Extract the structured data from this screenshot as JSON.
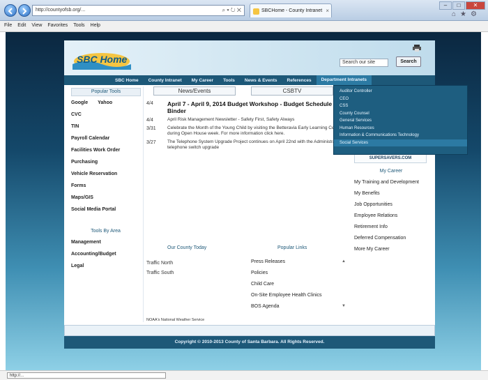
{
  "browser": {
    "address": "http://countyofsb.org/...",
    "tab_title": "SBCHome - County Intranet",
    "menu": [
      "File",
      "Edit",
      "View",
      "Favorites",
      "Tools",
      "Help"
    ],
    "status": "http://..."
  },
  "site": {
    "logo_text": "SBC Home",
    "search_placeholder": "Search our site",
    "search_button": "Search",
    "nav": [
      "SBC Home",
      "County Intranet",
      "My Career",
      "Tools",
      "News & Events",
      "References",
      "Department Intranets"
    ],
    "dropdown": [
      "Auditor Controller",
      "CEO",
      "CSS",
      "County Counsel",
      "General Services",
      "Human Resources",
      "Information & Communications Technology",
      "Social Services"
    ],
    "left": {
      "popular_tools_title": "Popular Tools",
      "tools": [
        [
          "Google",
          "Yahoo"
        ],
        [
          "CVC"
        ],
        [
          "TIN"
        ],
        [
          "Payroll Calendar"
        ],
        [
          "Facilities Work Order"
        ],
        [
          "Purchasing"
        ],
        [
          "Vehicle Reservation"
        ],
        [
          "Forms"
        ],
        [
          "Maps/GIS"
        ],
        [
          "Social Media Portal"
        ]
      ],
      "tools_by_area_title": "Tools By Area",
      "areas": [
        "Management",
        "Accounting/Budget",
        "Legal"
      ]
    },
    "center": {
      "tab_news": "News/Events",
      "tab_csbtv": "CSBTV",
      "news": [
        {
          "date": "4/4",
          "text": "April 7 - April 9, 2014 Budget Workshop - Budget Schedule and Binder",
          "big": true
        },
        {
          "date": "4/4",
          "text": "April Risk Management Newsletter - Safety First, Safety Always",
          "big": false
        },
        {
          "date": "3/31",
          "text": "Celebrate the Month of the Young Child by visiting the Betteravia Early Learning Center during Open House week. For more information click here.",
          "big": false
        },
        {
          "date": "3/27",
          "text": "The Telephone System Upgrade Project continues on April 22nd with the Administration telephone switch upgrade",
          "big": false
        }
      ],
      "county_today_title": "Our County Today",
      "popular_links_title": "Popular Links",
      "traffic": [
        "Traffic North",
        "Traffic South"
      ],
      "popular_links": [
        "Press Releases",
        "Policies",
        "Child Care",
        "On-Site Employee Health Clinics",
        "BOS Agenda"
      ],
      "weather": "NOAA's National Weather Service"
    },
    "right": {
      "super_banner": "SUPERSAVERS.COM",
      "career_title": "My Career",
      "career_links": [
        "My Training and Development",
        "My Benefits",
        "Job Opportunities",
        "Employee Relations",
        "Retirement Info",
        "Deferred Compensation",
        "More My Career"
      ]
    },
    "copyright": "Copyright © 2010-2013 County of Santa Barbara. All Rights Reserved."
  }
}
